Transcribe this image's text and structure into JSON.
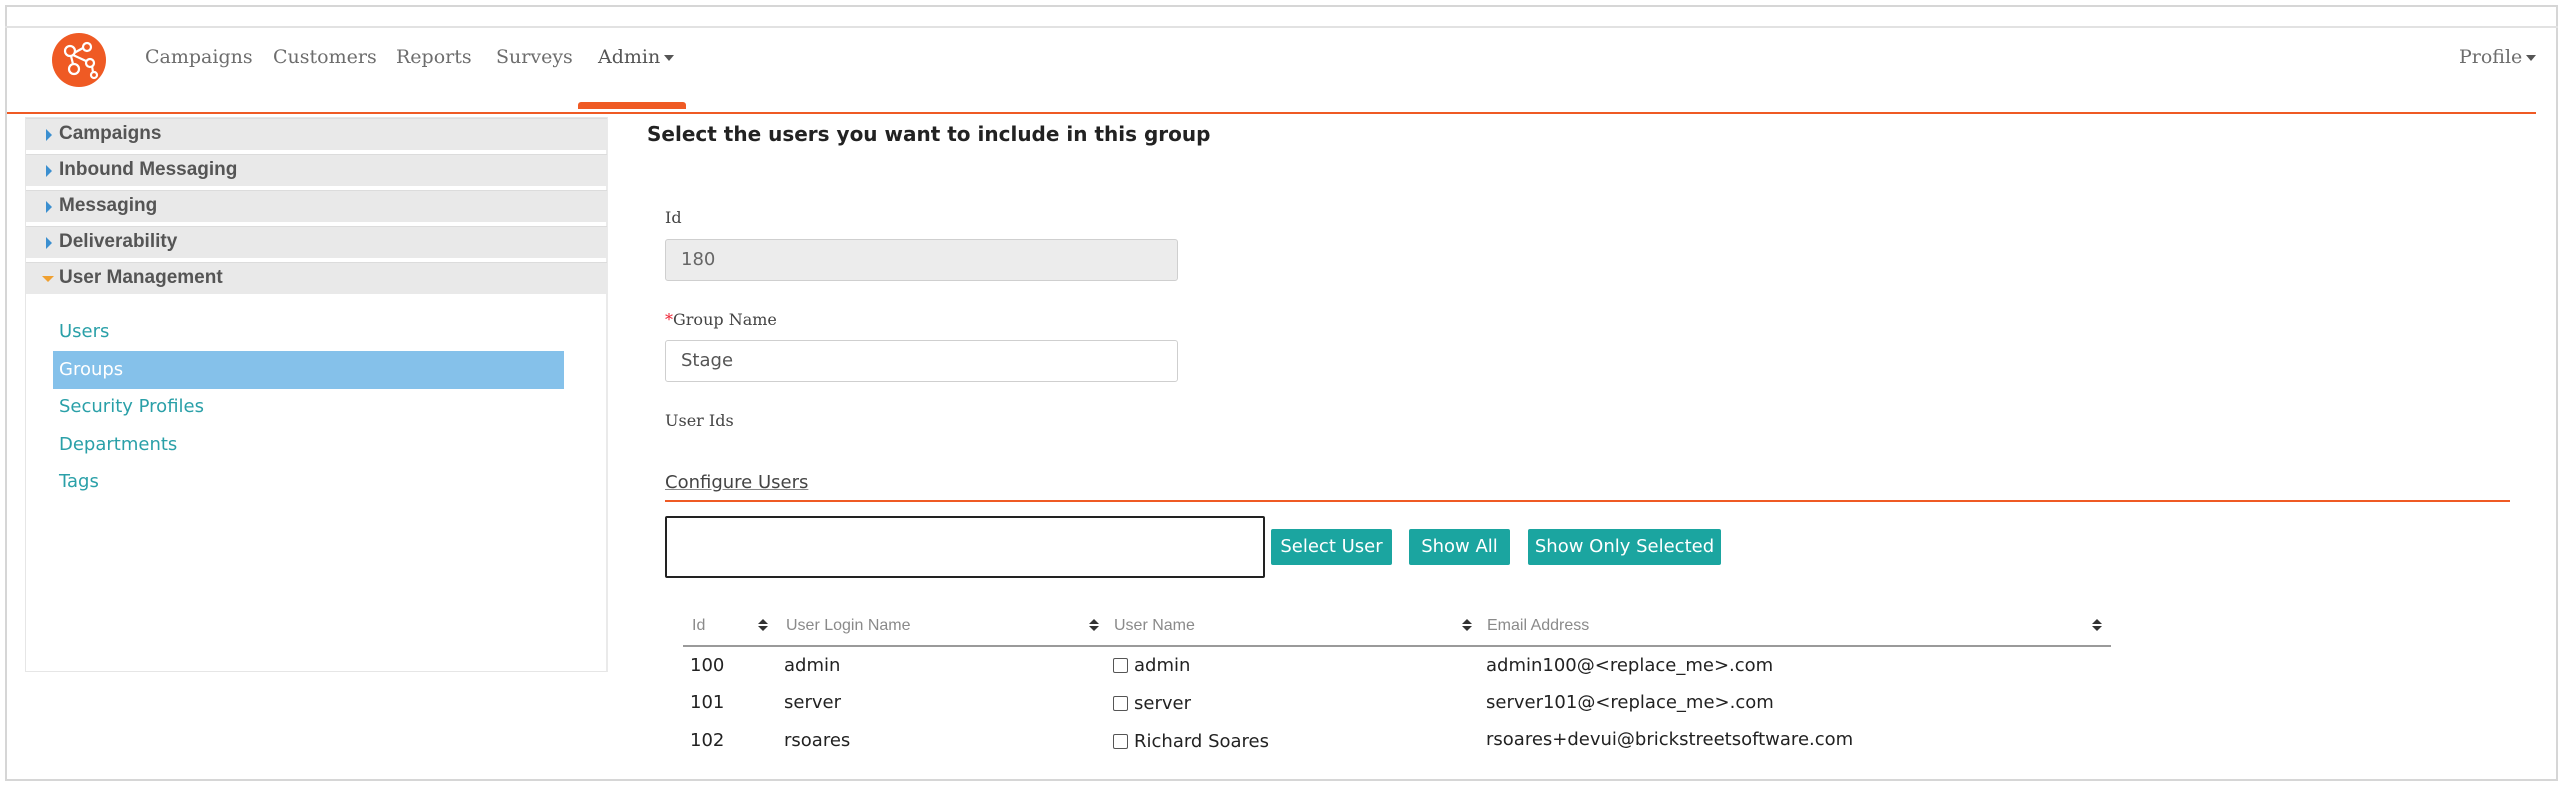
{
  "nav": {
    "items": [
      "Campaigns",
      "Customers",
      "Reports",
      "Surveys",
      "Admin"
    ],
    "profile": "Profile",
    "accent": "#ef5a24"
  },
  "sidebar": {
    "sections": [
      "Campaigns",
      "Inbound Messaging",
      "Messaging",
      "Deliverability",
      "User Management"
    ],
    "links": [
      "Users",
      "Groups",
      "Security Profiles",
      "Departments",
      "Tags"
    ],
    "active_link": "Groups"
  },
  "main": {
    "title": "Select the users you want to include in this group",
    "id_label": "Id",
    "id_value": "180",
    "required_mark": "*",
    "group_name_label": "Group Name",
    "group_name_value": "Stage",
    "user_ids_label": "User Ids",
    "configure_title": "Configure Users",
    "search_value": "",
    "buttons": {
      "select_user": "Select User",
      "show_all": "Show All",
      "show_only_selected": "Show Only Selected"
    },
    "button_color": "#1ba5a0"
  },
  "table": {
    "columns": [
      "Id",
      "User Login Name",
      "User Name",
      "Email Address"
    ],
    "rows": [
      {
        "id": "100",
        "login": "admin",
        "name": "admin",
        "email": "admin100@<replace_me>.com"
      },
      {
        "id": "101",
        "login": "server",
        "name": "server",
        "email": "server101@<replace_me>.com"
      },
      {
        "id": "102",
        "login": "rsoares",
        "name": "Richard Soares",
        "email": "rsoares+devui@brickstreetsoftware.com"
      }
    ]
  }
}
